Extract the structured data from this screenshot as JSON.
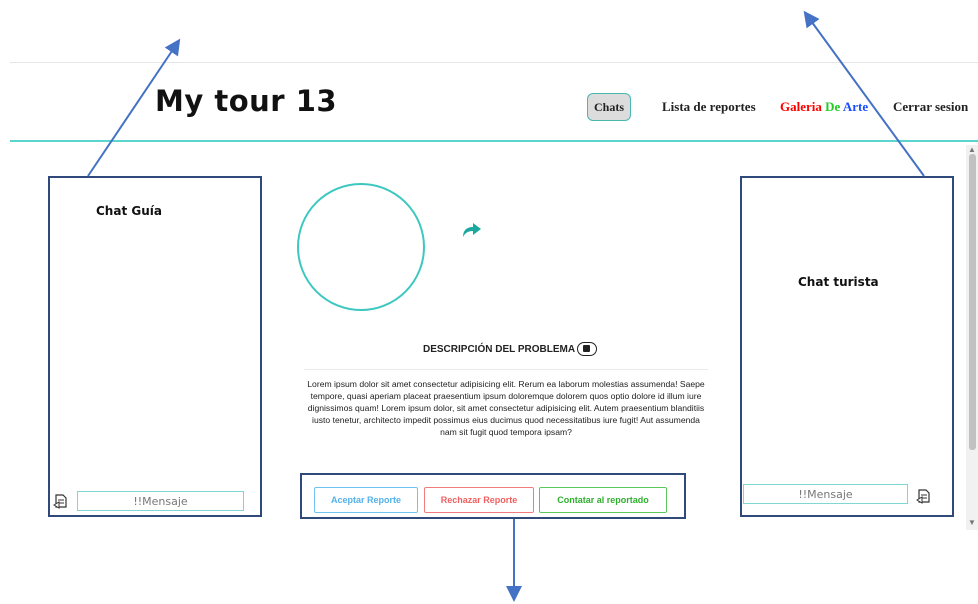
{
  "header": {
    "logo": "My tour 13",
    "nav": {
      "chats": "Chats",
      "reportes": "Lista de reportes",
      "galeria_1": "Galeria",
      "galeria_2": " De",
      "galeria_3": " Arte",
      "cerrar": "Cerrar sesion"
    }
  },
  "left_chat": {
    "title": "Chat Guía",
    "placeholder": "!!Mensaje"
  },
  "right_chat": {
    "title": "Chat turista",
    "placeholder": "!!Mensaje"
  },
  "problem": {
    "title": "DESCRIPCIÓN DEL PROBLEMA",
    "text": "Lorem ipsum dolor sit amet consectetur adipisicing elit. Rerum ea laborum molestias assumenda! Saepe tempore, quasi aperiam placeat praesentium ipsum doloremque dolorem quos optio dolore id illum iure dignissimos quam! Lorem ipsum dolor, sit amet consectetur adipisicing elit. Autem praesentium blanditiis iusto tenetur, architecto impedit possimus eius ducimus quod necessitatibus iure fugit! Aut assumenda nam sit fugit quod tempora ipsam?"
  },
  "actions": {
    "accept": "Aceptar Reporte",
    "reject": "Rechazar Reporte",
    "contact": "Contatar al reportado"
  },
  "icons": {
    "send": "send-message-icon",
    "share": "share-arrow-icon",
    "description": "description-toggle-icon"
  },
  "colors": {
    "teal": "#3cc8c0",
    "panel_border": "#2f4a7a",
    "arrow": "#4472c4",
    "accept": "#53b2ea",
    "reject": "#f06060",
    "contact": "#2fae2f"
  }
}
